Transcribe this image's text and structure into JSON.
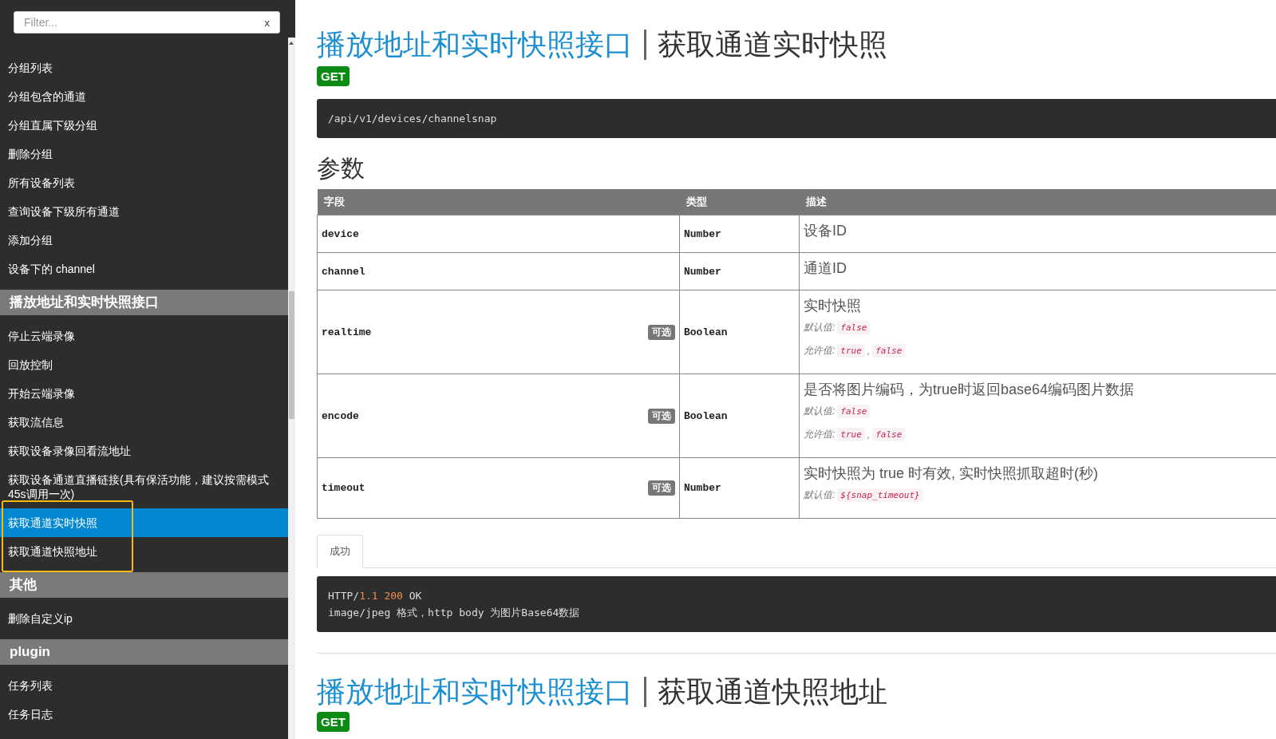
{
  "sidebar": {
    "filter": {
      "placeholder": "Filter...",
      "clear": "x"
    },
    "groups": [
      {
        "items": [
          {
            "label": "分组列表",
            "selected": false,
            "outlined": false
          },
          {
            "label": "分组包含的通道",
            "selected": false,
            "outlined": false
          },
          {
            "label": "分组直属下级分组",
            "selected": false,
            "outlined": false
          },
          {
            "label": "删除分组",
            "selected": false,
            "outlined": false
          },
          {
            "label": "所有设备列表",
            "selected": false,
            "outlined": false
          },
          {
            "label": "查询设备下级所有通道",
            "selected": false,
            "outlined": false
          },
          {
            "label": "添加分组",
            "selected": false,
            "outlined": false
          },
          {
            "label": "设备下的 channel",
            "selected": false,
            "outlined": false
          }
        ]
      },
      {
        "header": "播放地址和实时快照接口",
        "items": [
          {
            "label": "停止云端录像",
            "selected": false,
            "outlined": false
          },
          {
            "label": "回放控制",
            "selected": false,
            "outlined": false
          },
          {
            "label": "开始云端录像",
            "selected": false,
            "outlined": false
          },
          {
            "label": "获取流信息",
            "selected": false,
            "outlined": false
          },
          {
            "label": "获取设备录像回看流地址",
            "selected": false,
            "outlined": false
          },
          {
            "label": "获取设备通道直播链接(具有保活功能，建议按需模式45s调用一次)",
            "selected": false,
            "outlined": false
          },
          {
            "label": "获取通道实时快照",
            "selected": true,
            "outlined": true
          },
          {
            "label": "获取通道快照地址",
            "selected": false,
            "outlined": true
          }
        ]
      },
      {
        "header": "其他",
        "items": [
          {
            "label": "删除自定义ip",
            "selected": false,
            "outlined": false
          }
        ]
      },
      {
        "header": "plugin",
        "items": [
          {
            "label": "任务列表",
            "selected": false,
            "outlined": false
          },
          {
            "label": "任务日志",
            "selected": false,
            "outlined": false
          }
        ]
      }
    ]
  },
  "sections": [
    {
      "group": "播放地址和实时快照接口",
      "title": "获取通道实时快照",
      "method": "GET",
      "path": "/api/v1/devices/channelsnap",
      "params_heading": "参数",
      "params": {
        "columns": [
          "字段",
          "类型",
          "描述"
        ],
        "rows": [
          {
            "field": "device",
            "type": "Number",
            "description": "设备ID"
          },
          {
            "field": "channel",
            "type": "Number",
            "description": "通道ID"
          },
          {
            "field": "realtime",
            "badge": "可选",
            "type": "Boolean",
            "description": "实时快照",
            "default": {
              "label": "默认值:",
              "value": "false"
            },
            "allowed": {
              "label": "允许值:",
              "values": [
                "true",
                "false"
              ],
              "separator": ","
            }
          },
          {
            "field": "encode",
            "badge": "可选",
            "type": "Boolean",
            "description": "是否将图片编码，为true时返回base64编码图片数据",
            "default": {
              "label": "默认值:",
              "value": "false"
            },
            "allowed": {
              "label": "允许值:",
              "values": [
                "true",
                "false"
              ],
              "separator": ","
            }
          },
          {
            "field": "timeout",
            "badge": "可选",
            "type": "Number",
            "description": "实时快照为 true 时有效, 实时快照抓取超时(秒)",
            "default": {
              "label": "默认值:",
              "value": "${snap_timeout}"
            }
          }
        ]
      },
      "response_tabs": [
        {
          "label": "成功",
          "selected": true
        }
      ],
      "response_lines": [
        [
          {
            "text": "HTTP/",
            "kind": "plain"
          },
          {
            "text": "1.1",
            "kind": "number"
          },
          {
            "text": "200",
            "kind": "number",
            "space_before": true
          },
          {
            "text": " OK",
            "kind": "plain"
          }
        ],
        [
          {
            "text": "image/jpeg 格式，http body 为图片Base64数据",
            "kind": "plain"
          }
        ]
      ]
    },
    {
      "group": "播放地址和实时快照接口",
      "title": "获取通道快照地址",
      "method": "GET"
    }
  ]
}
